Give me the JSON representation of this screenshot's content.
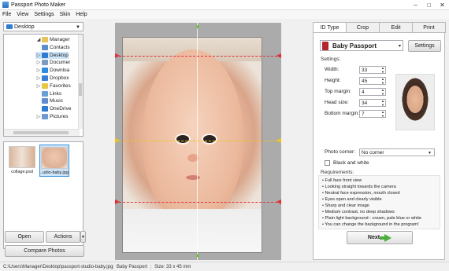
{
  "window": {
    "title": "Passport Photo Maker",
    "minimize": "–",
    "maximize": "□",
    "close": "✕"
  },
  "menu": [
    "File",
    "View",
    "Settings",
    "Skin",
    "Help"
  ],
  "folder_combo": {
    "value": "Desktop"
  },
  "tree": [
    {
      "label": "Manager",
      "color": "#e8c35b",
      "expand": "◢",
      "sel": false
    },
    {
      "label": "Contacts",
      "color": "#5d8fc8",
      "expand": "",
      "sel": false
    },
    {
      "label": "Desktop",
      "color": "#2f7bd1",
      "expand": "▷",
      "sel": true
    },
    {
      "label": "Documer",
      "color": "#7d9bc1",
      "expand": "▷",
      "sel": false
    },
    {
      "label": "Downloa",
      "color": "#2d8be0",
      "expand": "▷",
      "sel": false
    },
    {
      "label": "Dropbox",
      "color": "#3a7fd6",
      "expand": "▷",
      "sel": false
    },
    {
      "label": "Favorites",
      "color": "#e9c645",
      "expand": "▷",
      "sel": false
    },
    {
      "label": "Links",
      "color": "#6a9fd6",
      "expand": "",
      "sel": false
    },
    {
      "label": "Music",
      "color": "#5e8ccf",
      "expand": "",
      "sel": false
    },
    {
      "label": "OneDrive",
      "color": "#2f7bd1",
      "expand": "",
      "sel": false
    },
    {
      "label": "Pictures",
      "color": "#6e9ad0",
      "expand": "▷",
      "sel": false
    }
  ],
  "thumbnails": [
    {
      "caption": "collage.psd",
      "selected": false
    },
    {
      "caption": "..udio-baby.jpg",
      "selected": true
    }
  ],
  "buttons": {
    "open": "Open",
    "actions": "Actions",
    "compare": "Compare Photos",
    "more": "▾"
  },
  "tabs": [
    "ID Type",
    "Crop",
    "Edit",
    "Print"
  ],
  "active_tab": 0,
  "id_type": {
    "preset": "Baby Passport",
    "preset_arrow": "▾",
    "settings_button": "Settings",
    "settings_label": "Settings:",
    "fields": [
      {
        "label": "Width:",
        "value": "33"
      },
      {
        "label": "Height:",
        "value": "45"
      },
      {
        "label": "Top margin:",
        "value": "4"
      },
      {
        "label": "Head size:",
        "value": "34"
      },
      {
        "label": "Bottom margin:",
        "value": "7"
      }
    ],
    "photo_corner_label": "Photo corner:",
    "photo_corner_value": "No corner",
    "bw_label": "Black and white",
    "bw_checked": false,
    "requirements_label": "Requirements:",
    "requirements": [
      "Full face front view",
      "Looking straight towards the camera",
      "Neutral face expression, mouth closed",
      "Eyes open and clearly visible",
      "Sharp and clear image",
      "Medium contrast, no deep shadows",
      "Plain light background - cream, pale blue or white",
      "You can change the background in the program!"
    ],
    "next_button": "Next"
  },
  "status": {
    "path": "C:\\Users\\Manager\\Desktop\\passport-studio-baby.jpg",
    "preset": "Baby Passport",
    "size": "Size: 33 x 45 mm"
  },
  "colors": {
    "accent": "#3d8fd8",
    "guide_red": "#e0313a",
    "guide_yellow": "#f0c419",
    "marker_green": "#6abf3b"
  }
}
